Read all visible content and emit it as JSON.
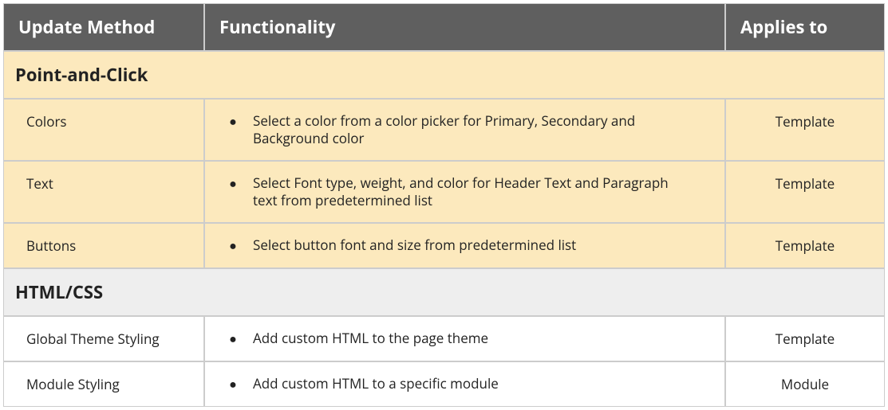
{
  "headers": {
    "update_method": "Update Method",
    "functionality": "Functionality",
    "applies_to": "Applies to"
  },
  "sections": [
    {
      "title": "Point-and-Click",
      "style": "pac",
      "rows": [
        {
          "name": "Colors",
          "functionality": "Select a color from a color picker for Primary, Secondary and Background color",
          "applies_to": "Template"
        },
        {
          "name": "Text",
          "functionality": "Select Font type, weight, and color for Header Text and Paragraph text from predetermined list",
          "applies_to": "Template"
        },
        {
          "name": "Buttons",
          "functionality": "Select button font and size from predetermined list",
          "applies_to": "Template"
        }
      ]
    },
    {
      "title": "HTML/CSS",
      "style": "html",
      "rows": [
        {
          "name": "Global Theme Styling",
          "functionality": "Add custom HTML to the page theme",
          "applies_to": "Template"
        },
        {
          "name": "Module Styling",
          "functionality": "Add custom HTML to a specific module",
          "applies_to": "Module"
        }
      ]
    }
  ],
  "chart_data": {
    "type": "table",
    "columns": [
      "Update Method",
      "Functionality",
      "Applies to"
    ],
    "groups": [
      {
        "group": "Point-and-Click",
        "rows": [
          [
            "Colors",
            "Select a color from a color picker for Primary, Secondary and Background color",
            "Template"
          ],
          [
            "Text",
            "Select Font type, weight, and color for Header Text and Paragraph text from predetermined list",
            "Template"
          ],
          [
            "Buttons",
            "Select button font and size from predetermined list",
            "Template"
          ]
        ]
      },
      {
        "group": "HTML/CSS",
        "rows": [
          [
            "Global Theme Styling",
            "Add custom HTML to the page theme",
            "Template"
          ],
          [
            "Module Styling",
            "Add custom HTML to a specific module",
            "Module"
          ]
        ]
      }
    ]
  }
}
